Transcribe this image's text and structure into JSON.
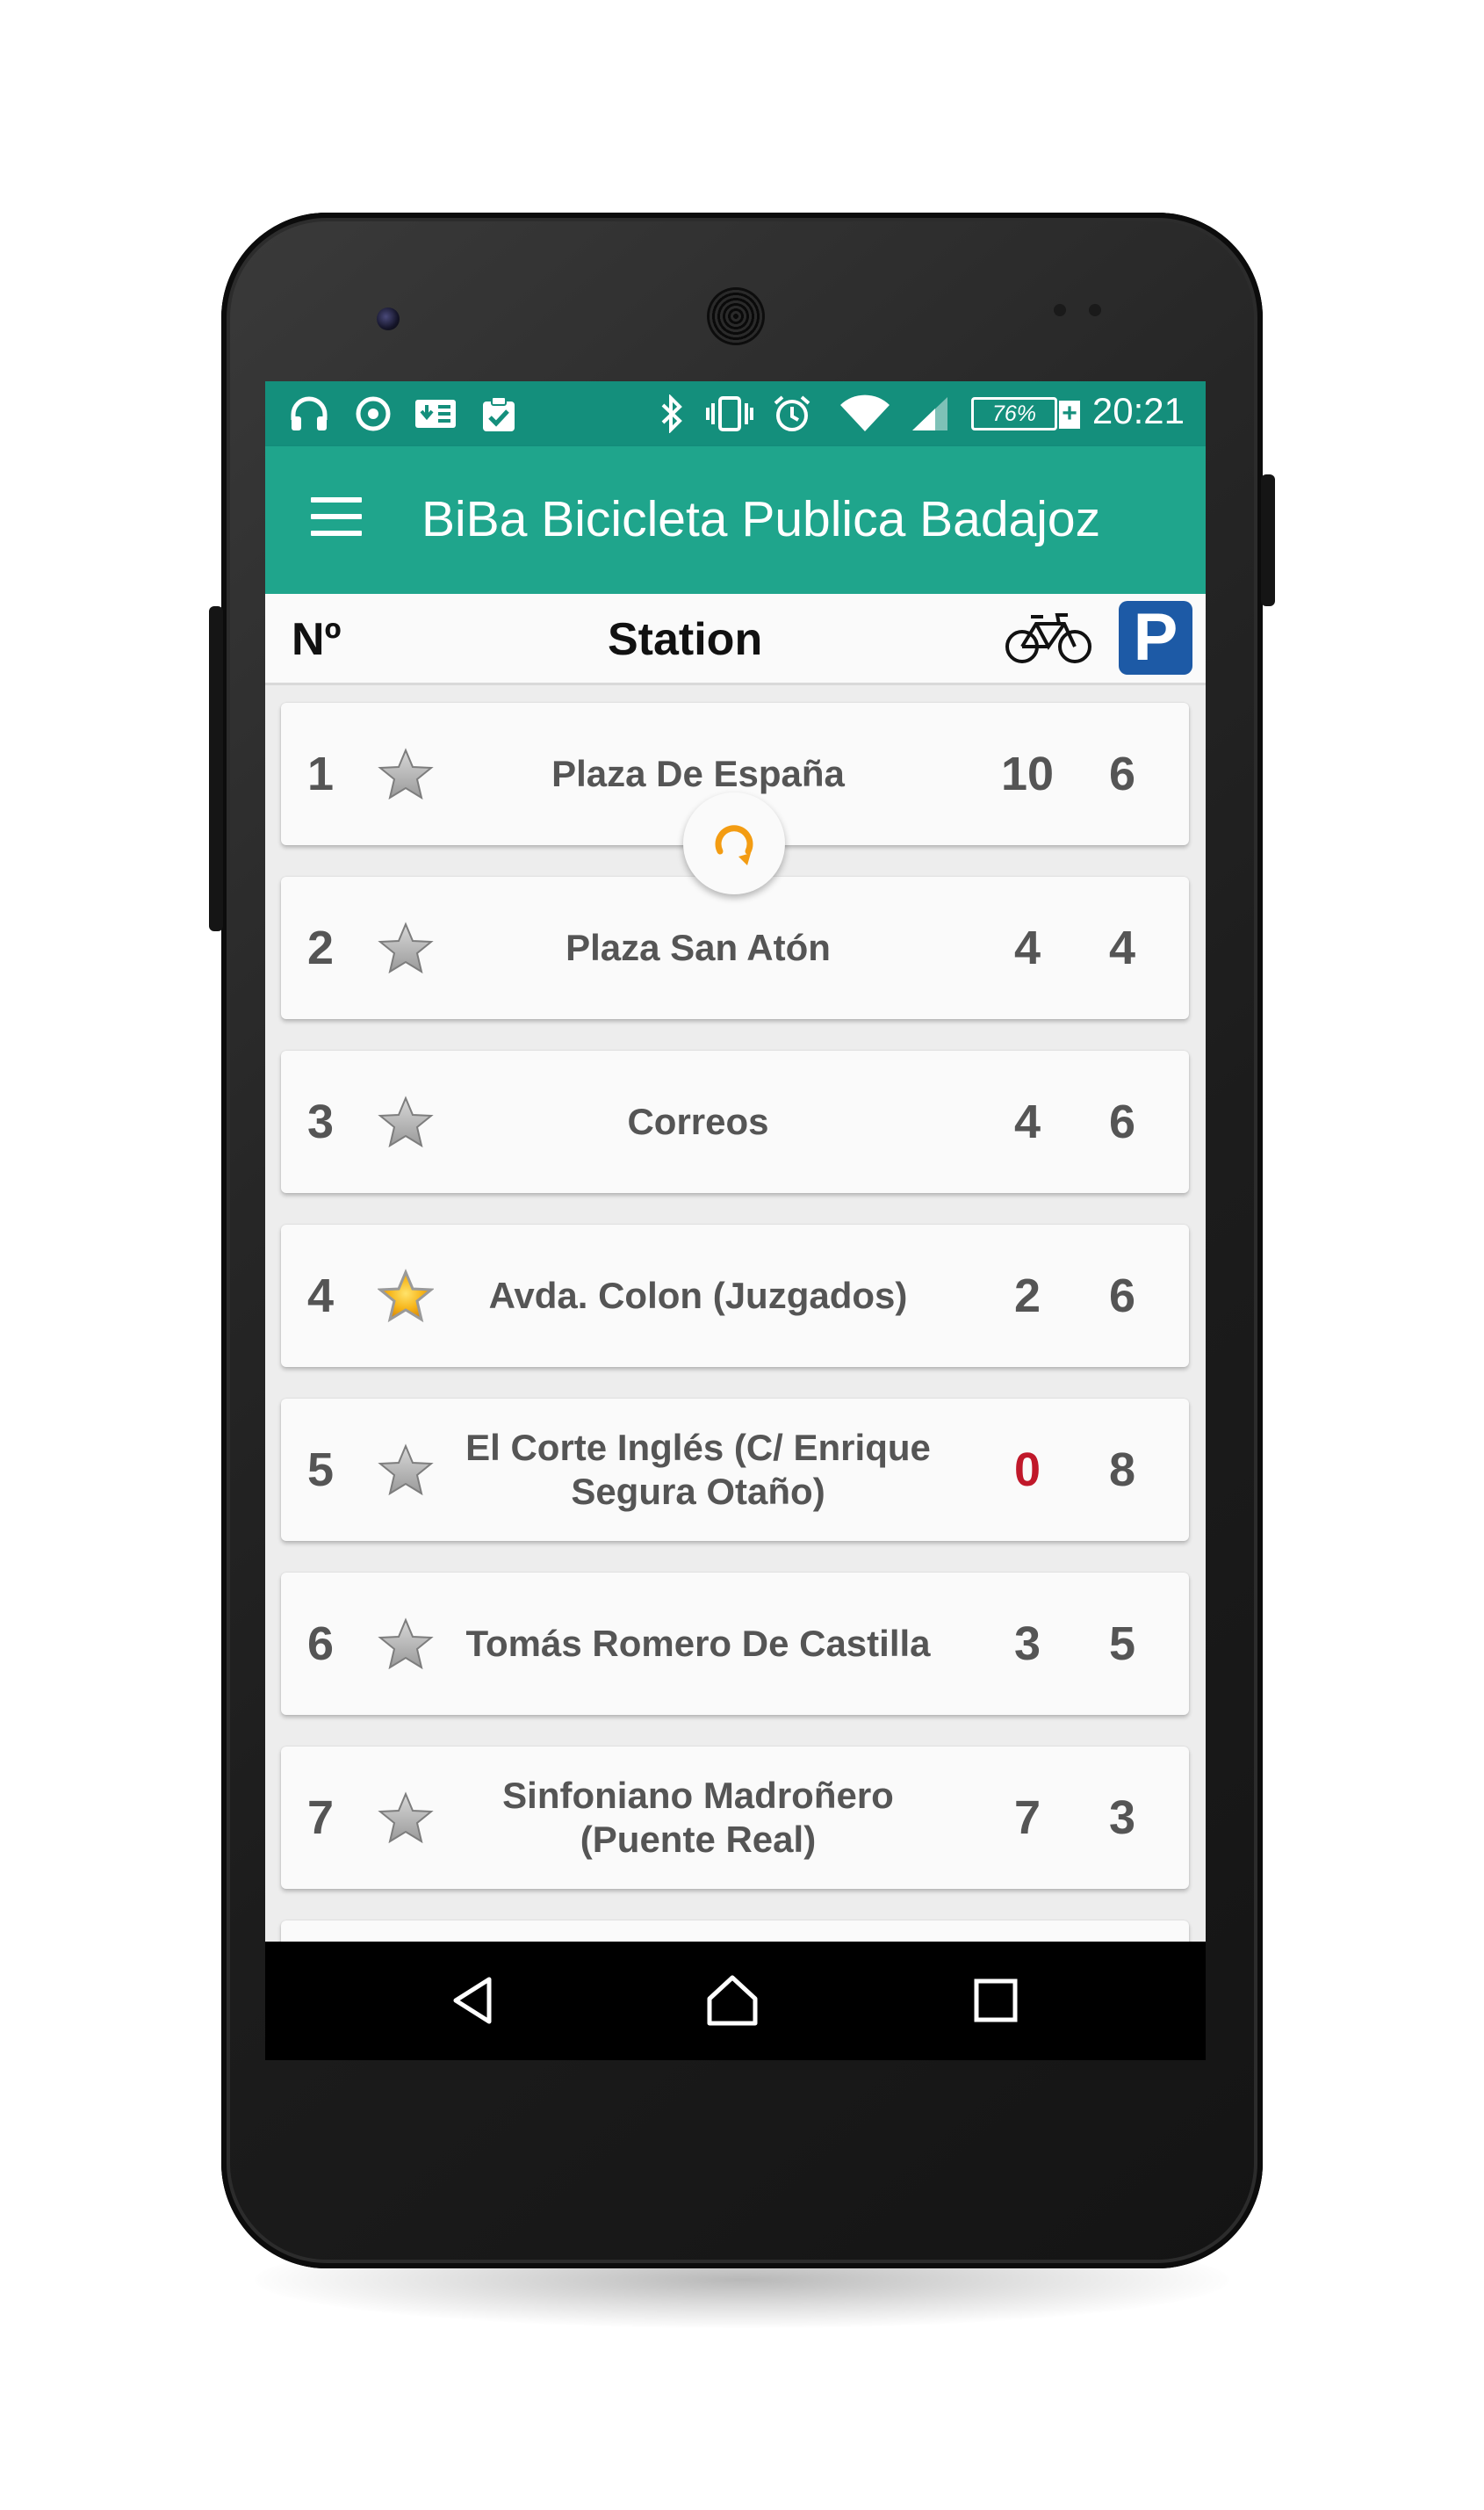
{
  "status_bar": {
    "time": "20:21",
    "battery": "76%",
    "battery_plus": "+",
    "left_icons": [
      "headphones-icon",
      "sync-circle-icon",
      "download-icon",
      "clipboard-check-icon"
    ],
    "right_icons": [
      "bluetooth-icon",
      "vibrate-icon",
      "alarm-icon",
      "wifi-icon",
      "signal-icon",
      "battery-icon"
    ]
  },
  "app_bar": {
    "title": "BiBa Bicicleta Publica Badajoz"
  },
  "header": {
    "number_label": "Nº",
    "station_label": "Station",
    "bikes_icon": "bicycle-icon",
    "parking_label": "P"
  },
  "stations": [
    {
      "number": "1",
      "name": "Plaza De España",
      "bikes": "10",
      "slots": "6",
      "favorite": false
    },
    {
      "number": "2",
      "name": "Plaza San Atón",
      "bikes": "4",
      "slots": "4",
      "favorite": false
    },
    {
      "number": "3",
      "name": "Correos",
      "bikes": "4",
      "slots": "6",
      "favorite": false
    },
    {
      "number": "4",
      "name": "Avda. Colon (Juzgados)",
      "bikes": "2",
      "slots": "6",
      "favorite": true
    },
    {
      "number": "5",
      "name": "El Corte Inglés (C/ Enrique Segura Otaño)",
      "bikes": "0",
      "slots": "8",
      "favorite": false
    },
    {
      "number": "6",
      "name": "Tomás Romero De Castilla",
      "bikes": "3",
      "slots": "5",
      "favorite": false
    },
    {
      "number": "7",
      "name": "Sinfoniano Madroñero (Puente Real)",
      "bikes": "7",
      "slots": "3",
      "favorite": false
    }
  ],
  "colors": {
    "status_bar": "#148f7c",
    "app_bar": "#1fa58c",
    "parking": "#1d5aa6",
    "favorite_star": "#f6b418",
    "empty_bikes": "#c0182a",
    "refresh_accent": "#f39c12"
  },
  "nav_bar": {
    "icons": [
      "back-icon",
      "home-icon",
      "recents-icon"
    ]
  }
}
